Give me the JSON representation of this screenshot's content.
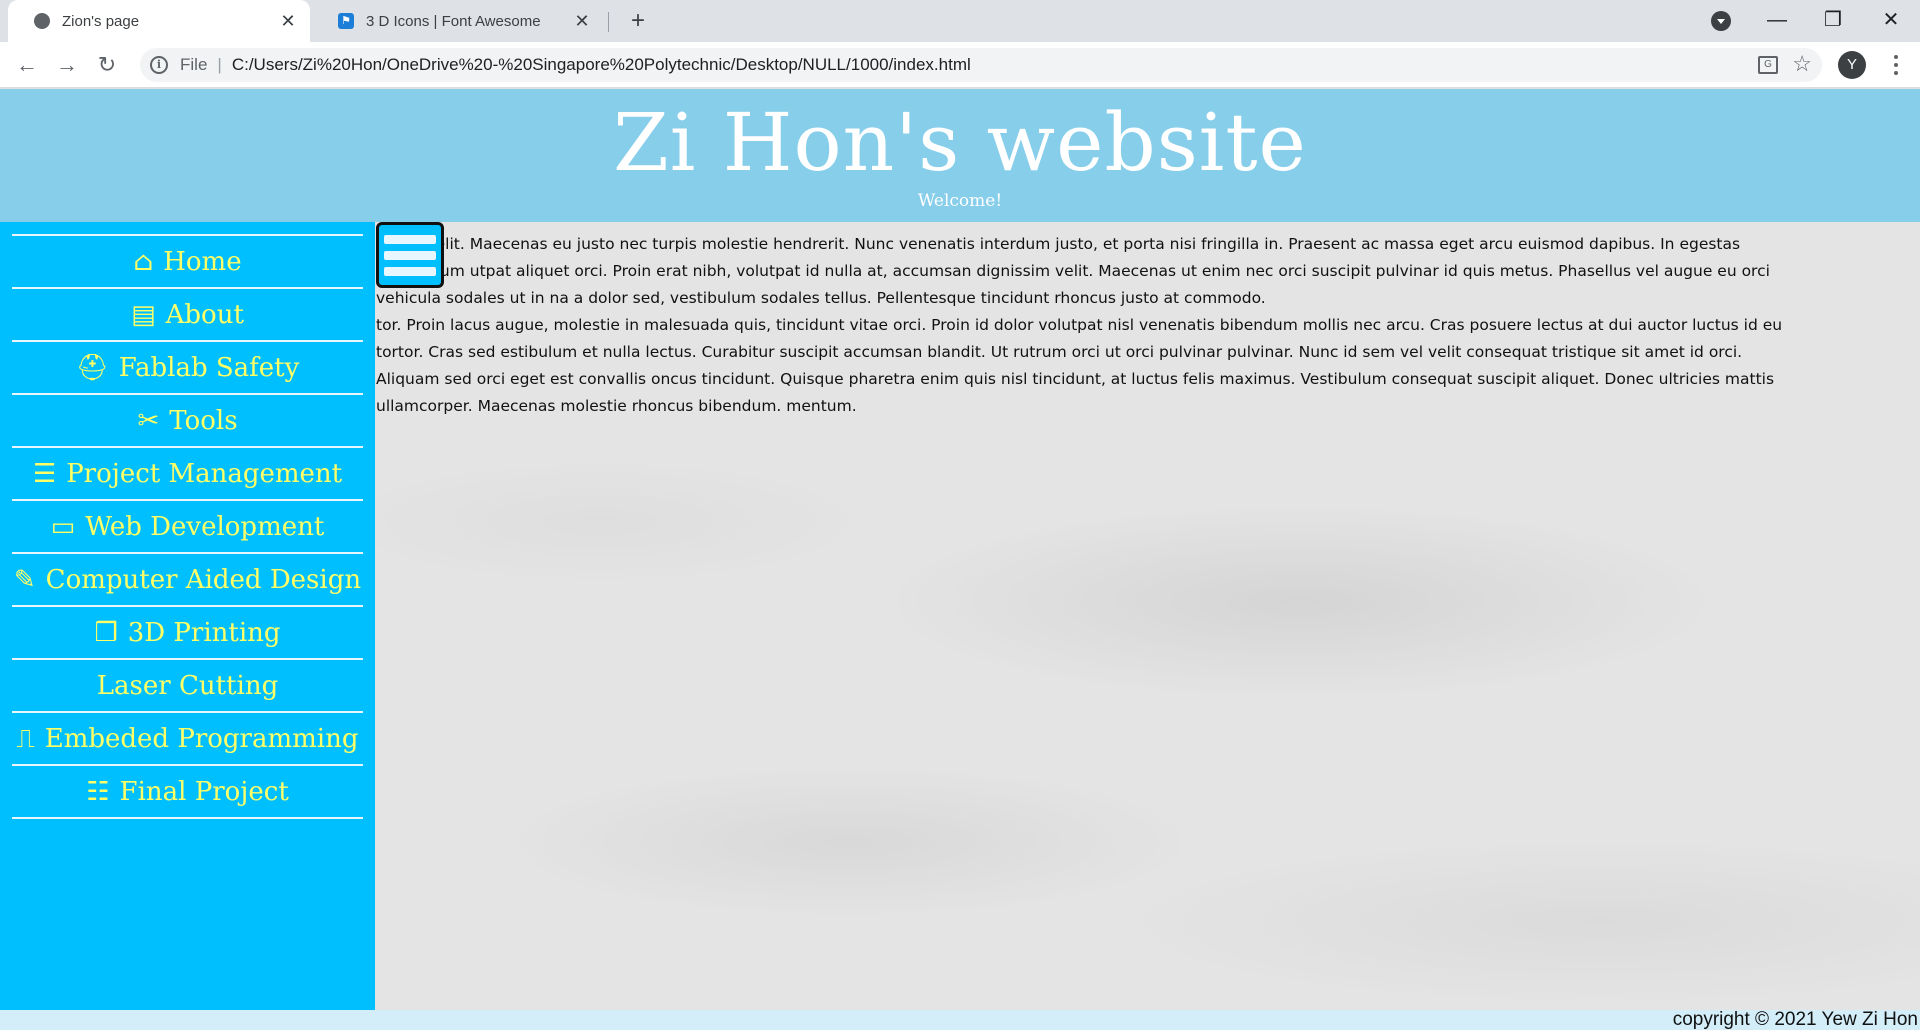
{
  "browser": {
    "tabs": [
      {
        "title": "Zion's page",
        "active": true
      },
      {
        "title": "3 D Icons | Font Awesome",
        "active": false
      }
    ],
    "new_tab": "+",
    "address": {
      "scheme": "File",
      "url": "C:/Users/Zi%20Hon/OneDrive%20-%20Singapore%20Polytechnic/Desktop/NULL/1000/index.html"
    },
    "profile_initial": "Y"
  },
  "header": {
    "title": "Zi Hon's website",
    "subtitle": "Welcome!"
  },
  "sidebar": {
    "items": [
      {
        "label": "Home",
        "icon": "home-icon",
        "glyph": "⌂"
      },
      {
        "label": "About",
        "icon": "id-card-icon",
        "glyph": "▤"
      },
      {
        "label": "Fablab Safety",
        "icon": "hard-hat-icon",
        "glyph": "⛑"
      },
      {
        "label": "Tools",
        "icon": "tools-icon",
        "glyph": "✂"
      },
      {
        "label": "Project Management",
        "icon": "clipboard-list-icon",
        "glyph": "☰"
      },
      {
        "label": "Web Development",
        "icon": "window-icon",
        "glyph": "▭"
      },
      {
        "label": "Computer Aided Design",
        "icon": "pencil-ruler-icon",
        "glyph": "✎"
      },
      {
        "label": "3D Printing",
        "icon": "cubes-icon",
        "glyph": "❒"
      },
      {
        "label": "Laser Cutting",
        "icon": "",
        "glyph": ""
      },
      {
        "label": "Embeded Programming",
        "icon": "wave-square-icon",
        "glyph": "⎍"
      },
      {
        "label": "Final Project",
        "icon": "tasks-icon",
        "glyph": "☷"
      }
    ]
  },
  "main": {
    "paragraphs": [
      "piscing elit. Maecenas eu justo nec turpis molestie hendrerit. Nunc venenatis interdum justo, et porta nisi fringilla in. Praesent ac massa eget arcu euismod dapibus. In egestas elementum utpat aliquet orci. Proin erat nibh, volutpat id nulla at, accumsan dignissim velit. Maecenas ut enim nec orci suscipit pulvinar id quis metus. Phasellus vel augue eu orci vehicula sodales ut in na a dolor sed, vestibulum sodales tellus. Pellentesque tincidunt rhoncus justo at commodo.",
      "tor. Proin lacus augue, molestie in malesuada quis, tincidunt vitae orci. Proin id dolor volutpat nisl venenatis bibendum mollis nec arcu. Cras posuere lectus at dui auctor luctus id eu tortor. Cras sed estibulum et nulla lectus. Curabitur suscipit accumsan blandit. Ut rutrum orci ut orci pulvinar pulvinar. Nunc id sem vel velit consequat tristique sit amet id orci. Aliquam sed orci eget est convallis oncus tincidunt. Quisque pharetra enim quis nisl tincidunt, at luctus felis maximus. Vestibulum consequat suscipit aliquet. Donec ultricies mattis ullamcorper. Maecenas molestie rhoncus bibendum. mentum."
    ]
  },
  "footer": {
    "copyright": "copyright © 2021 Yew Zi Hon"
  },
  "colors": {
    "header_bg": "#87ceeb",
    "sidebar_bg": "#00bfff",
    "nav_text": "#ffff66",
    "content_bg": "#e4e4e4"
  }
}
